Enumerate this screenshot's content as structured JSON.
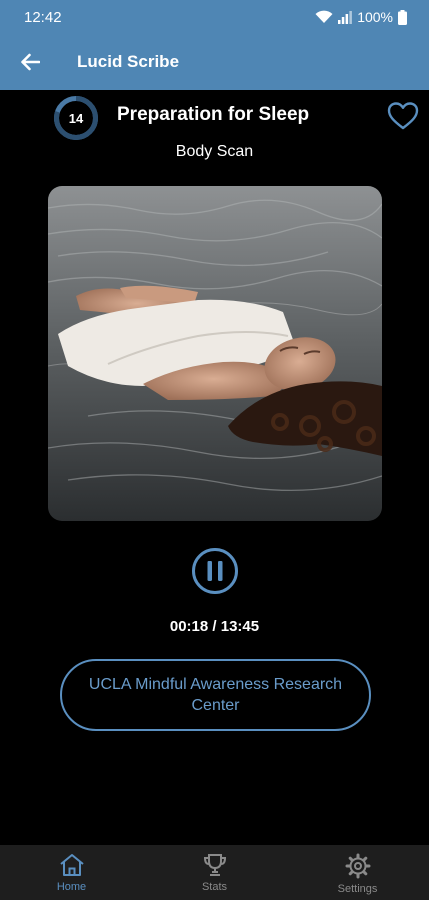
{
  "status_bar": {
    "time": "12:42",
    "battery": "100%"
  },
  "app_bar": {
    "title": "Lucid Scribe"
  },
  "player": {
    "session_number": "14",
    "progress_fraction": 0.8,
    "title": "Preparation for Sleep",
    "subtitle": "Body Scan",
    "time_display": "00:18 / 13:45",
    "link_label": "UCLA Mindful Awareness Research Center"
  },
  "nav": {
    "items": [
      {
        "label": "Home",
        "icon": "home-icon",
        "active": true
      },
      {
        "label": "Stats",
        "icon": "trophy-icon",
        "active": false
      },
      {
        "label": "Settings",
        "icon": "gear-icon",
        "active": false
      }
    ]
  },
  "colors": {
    "primary": "#4f86b4",
    "accent": "#5a8fc0",
    "background": "#000000",
    "nav_background": "#1e1e1e"
  }
}
